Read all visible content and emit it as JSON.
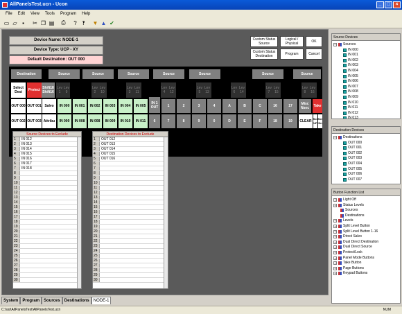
{
  "window": {
    "title": "AllPanelsTest.ucn - Ucon"
  },
  "menu": [
    "File",
    "Edit",
    "View",
    "Tools",
    "Program",
    "Help"
  ],
  "panel_header": {
    "device_name": "Device Name: NODE-1",
    "device_type": "Device Type: UCP - XY",
    "default_dest": "Default Destination: OUT  000"
  },
  "actions": {
    "custom_status_source": "Custom Status Source",
    "logical_physical": "Logical / Physical",
    "ok": "OK",
    "custom_status_dest": "Custom Status Destination",
    "program": "Program",
    "cancel": "Cancel"
  },
  "strip": {
    "row0": [
      "Destination",
      "Source",
      "Source",
      "Source",
      "Source",
      "Source",
      "Source",
      "Source"
    ],
    "row1_left": [
      "Select Dest",
      "Protect",
      "Shift18 Shift16"
    ],
    "levels": [
      [
        "Lev 1",
        "Lev 9"
      ],
      [
        "Lev 2",
        "Lev 10"
      ],
      [
        "Lev 3",
        "Lev 11"
      ],
      [
        "Lev 4",
        "Lev 12"
      ],
      [
        "Lev 5",
        "Lev 13"
      ],
      [
        "Lev 6",
        "Lev 14"
      ],
      [
        "Lev 7",
        "Lev 15"
      ],
      [
        "Lev 8",
        "Lev 16"
      ]
    ],
    "outs_top": [
      "OUT 000",
      "OUT 001"
    ],
    "outs_bot": [
      "OUT 002",
      "OUT 003"
    ],
    "salvo": "Salvo",
    "attribu": "Attribu",
    "ins_top": [
      "IN 000",
      "IN 001",
      "IN 002",
      "IN 003",
      "IN 004",
      "IN 005"
    ],
    "ins_bot": [
      "IN 008",
      "IN 009",
      "IN 010",
      "IN 011"
    ],
    "in1out": "IN 1 OUT",
    "keypad_top": [
      "1",
      "2",
      "3",
      "4",
      "A",
      "B",
      "C",
      "16",
      "17"
    ],
    "keypad_bot": [
      "6",
      "7",
      "8",
      "9",
      "0",
      "D",
      "E",
      "F",
      "18",
      "19"
    ],
    "misc_nsec": "Misc Nsec",
    "take": "Take",
    "clear": "CLEAR",
    "scr_up": "Scr UP",
    "scr_dn": "Scr Dn"
  },
  "exclude_source": {
    "title": "Source Devices to Exclude",
    "rows": [
      "IN  012",
      "IN  013",
      "IN  014",
      "IN  015",
      "IN  016",
      "IN  017",
      "IN  018",
      "",
      "",
      "",
      "",
      "",
      "",
      "",
      "",
      "",
      "",
      "",
      "",
      "",
      "",
      "",
      "",
      "",
      "",
      "",
      "",
      "",
      "",
      ""
    ]
  },
  "exclude_dest": {
    "title": "Destination Devices to Exclude",
    "rows": [
      "OUT 012",
      "OUT 013",
      "OUT 014",
      "OUT 015",
      "OUT 016",
      "",
      "",
      "",
      "",
      "",
      "",
      "",
      "",
      "",
      "",
      "",
      "",
      "",
      "",
      "",
      "",
      "",
      "",
      "",
      "",
      "",
      "",
      "",
      "",
      ""
    ]
  },
  "tabs": [
    "System",
    "Program",
    "Sources",
    "Destinations",
    "NODE-1"
  ],
  "status": {
    "path": "C:\\sat\\AllPanelsTest\\AllPanelsTest.ucn",
    "num": "NUM"
  },
  "source_devices": {
    "title": "Source Devices",
    "root": "Sources",
    "items": [
      "IN  000",
      "IN  001",
      "IN  002",
      "IN  003",
      "IN  004",
      "IN  005",
      "IN  006",
      "IN  007",
      "IN  008",
      "IN  009",
      "IN  010",
      "IN  011",
      "IN  012",
      "IN  013"
    ]
  },
  "dest_devices": {
    "title": "Destination Devices",
    "root": "Destinations",
    "items": [
      "OUT  000",
      "OUT  001",
      "OUT  002",
      "OUT  003",
      "OUT  004",
      "OUT  005",
      "OUT  006",
      "OUT  007"
    ]
  },
  "button_functions": {
    "title": "Button Function List",
    "items": [
      "Light Off",
      "Status Levels",
      "Sources",
      "Destinations",
      "Levels",
      "Split Level Button",
      "Split Level Button 1-16",
      "Direct Salvo",
      "Dual Direct Destination",
      "Dual Direct Source",
      "Protect/Lock",
      "Panel Mode Buttons",
      "Take Button",
      "Page Buttons",
      "Keypad Buttons"
    ]
  }
}
